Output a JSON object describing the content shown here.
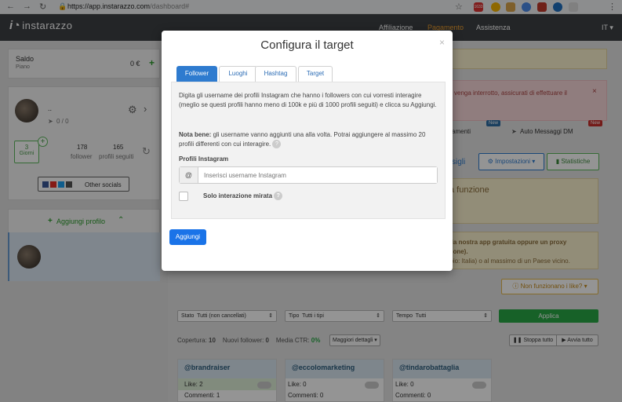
{
  "browser": {
    "url_host": "https://app.instarazzo.com",
    "url_path": "/dashboard#",
    "ext_badge": "1633"
  },
  "header": {
    "logo_mark": "i◔",
    "logo_text": "instarazzo",
    "nav": [
      "Affiliazione",
      "Pagamento",
      "Assistenza"
    ],
    "language": "IT ▾"
  },
  "sidebar": {
    "saldo_label": "Saldo",
    "saldo_sub": "Piano",
    "saldo_value": "0 €",
    "profile_name": "..",
    "profile_progress": "0 / 0",
    "giorni_value": "3",
    "giorni_label": "Giorni",
    "follower_value": "178",
    "follower_label": "follower",
    "seguiti_value": "165",
    "seguiti_label": "profili seguiti",
    "other_socials": "Other socials",
    "add_profile": "Aggiungi profilo"
  },
  "main": {
    "alert1": "venga interrotto, assicurati di effettuare il",
    "tabs_partial": "amenti",
    "badge_new": "New",
    "auto_messages": "Auto Messaggi DM",
    "gli": "sigli",
    "btn_impostazioni": "Impostazioni",
    "btn_statistiche": "Statistiche",
    "funzione": "a funzione",
    "proxy_line1": "e la nostra app gratuita oppure un proxy",
    "proxy_line2": "izione).",
    "proxy_line3": "ppio: Italia) o al massimo di un Paese vicino.",
    "not_working": "Non funzionano i like?",
    "filters": {
      "stato_label": "Stato",
      "stato_value": "Tutti (non cancellati)",
      "tipo_label": "Tipo",
      "tipo_value": "Tutti i tipi",
      "tempo_label": "Tempo",
      "tempo_value": "Tutti",
      "applica": "Applica"
    },
    "stats": {
      "copertura_label": "Copertura:",
      "copertura_value": "10",
      "nuovi_label": "Nuovi follower:",
      "nuovi_value": "0",
      "ctr_label": "Media CTR:",
      "ctr_value": "0%",
      "dettagli": "Maggiori dettagli ▾",
      "stop_all": "Stoppa tutto",
      "start_all": "Avvia tutto"
    },
    "tiles": [
      {
        "handle": "@brandraiser",
        "like": "Like: 2",
        "commenti": "Commenti: 1"
      },
      {
        "handle": "@eccolomarketing",
        "like": "Like: 0",
        "commenti": "Commenti: 0"
      },
      {
        "handle": "@tindarobattaglia",
        "like": "Like: 0",
        "commenti": "Commenti: 0"
      }
    ]
  },
  "modal": {
    "title": "Configura il target",
    "close": "×",
    "tabs": [
      "Follower",
      "Luoghi",
      "Hashtag",
      "Target"
    ],
    "description": "Digita gli username dei profili Instagram che hanno i followers con cui vorresti interagire (meglio se questi profili hanno meno di 100k e più di 1000 profili seguiti) e clicca su Aggiungi.",
    "note_bold": "Nota bene:",
    "note_text": " gli username vanno aggiunti una alla volta. Potrai aggiungere al massimo 20 profili differenti con cui interagire.",
    "field_label": "Profili Instagram",
    "at_symbol": "@",
    "input_placeholder": "Inserisci username Instagram",
    "checkbox_label": "Solo interazione mirata",
    "help_glyph": "?",
    "add_button": "Aggiungi"
  },
  "colors": {
    "accent_blue": "#2e7bcf",
    "button_blue": "#1a73e8",
    "green": "#5cb85c",
    "pagamento_orange": "#f0a030"
  }
}
